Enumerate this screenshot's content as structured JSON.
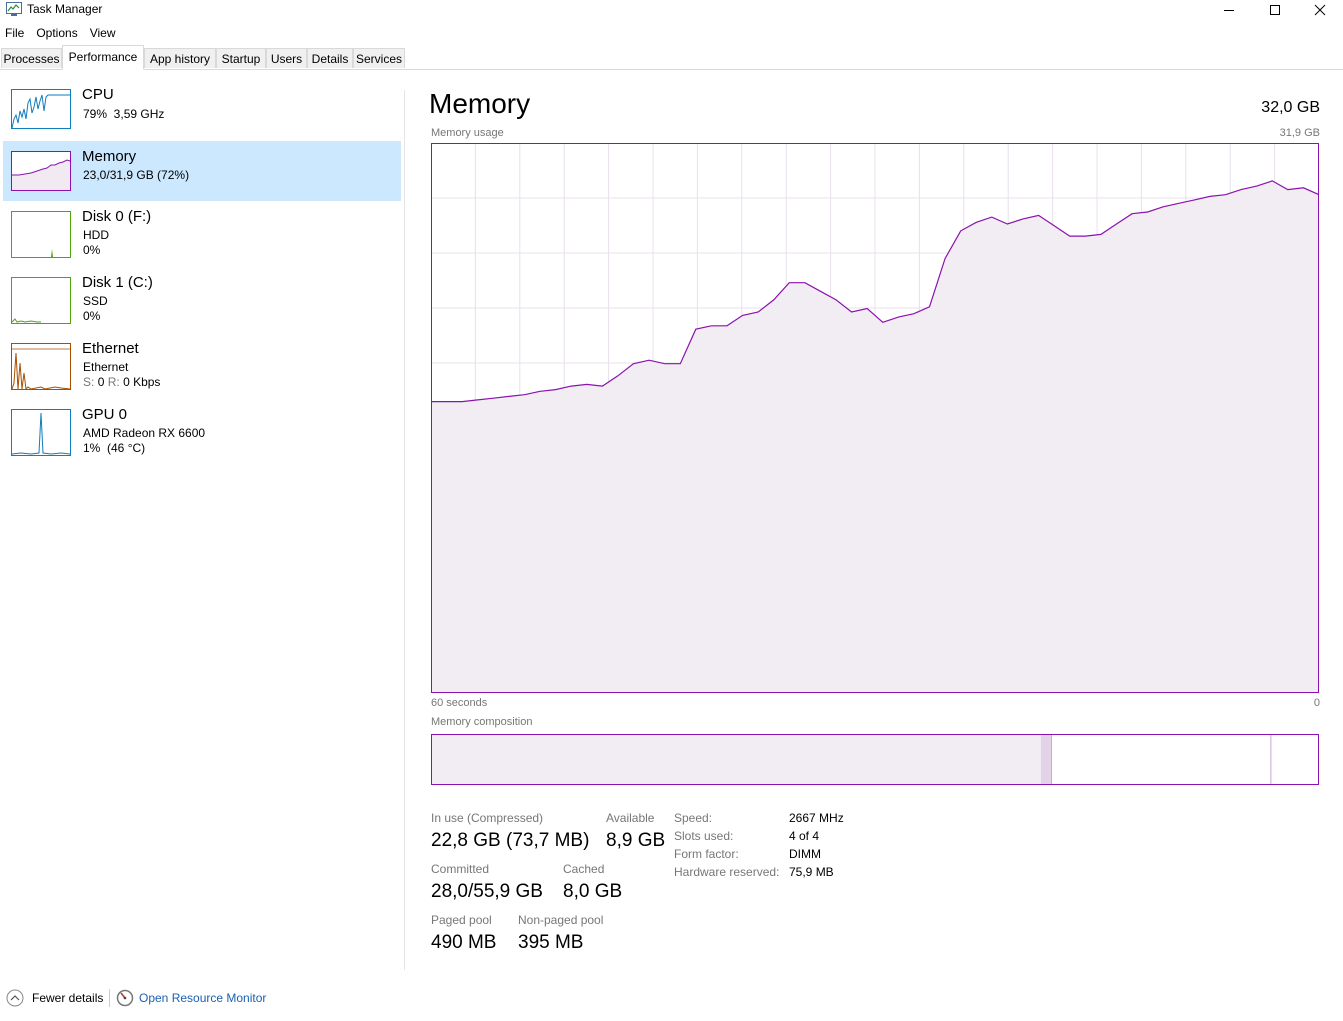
{
  "window": {
    "title": "Task Manager",
    "app_icon": "task-manager-icon"
  },
  "menu": [
    "File",
    "Options",
    "View"
  ],
  "tabs": [
    "Processes",
    "Performance",
    "App history",
    "Startup",
    "Users",
    "Details",
    "Services"
  ],
  "active_tab": "Performance",
  "sidebar": {
    "items": [
      {
        "title": "CPU",
        "sub1": "79%  3,59 GHz",
        "sub2": "",
        "color": "#117dbb"
      },
      {
        "title": "Memory",
        "sub1": "23,0/31,9 GB (72%)",
        "sub2": "",
        "color": "#8b12ae",
        "selected": true
      },
      {
        "title": "Disk 0 (F:)",
        "sub1": "HDD",
        "sub2": "0%",
        "color": "#4da60c"
      },
      {
        "title": "Disk 1 (C:)",
        "sub1": "SSD",
        "sub2": "0%",
        "color": "#4da60c"
      },
      {
        "title": "Ethernet",
        "sub1": "Ethernet",
        "sub2_s": "S:",
        "sub2_s_val": "0",
        "sub2_r": "R:",
        "sub2_r_val": "0 Kbps",
        "color": "#a74f01"
      },
      {
        "title": "GPU 0",
        "sub1": "AMD Radeon RX 6600",
        "sub2": "1%  (46 °C)",
        "color": "#117dbb"
      }
    ]
  },
  "main": {
    "title": "Memory",
    "total": "32,0 GB",
    "usage_label": "Memory usage",
    "usage_max": "31,9 GB",
    "time_left": "60 seconds",
    "time_right": "0",
    "composition_label": "Memory composition",
    "stats": {
      "in_use_label": "In use (Compressed)",
      "in_use": "22,8 GB (73,7 MB)",
      "available_label": "Available",
      "available": "8,9 GB",
      "committed_label": "Committed",
      "committed": "28,0/55,9 GB",
      "cached_label": "Cached",
      "cached": "8,0 GB",
      "paged_label": "Paged pool",
      "paged": "490 MB",
      "nonpaged_label": "Non-paged pool",
      "nonpaged": "395 MB"
    },
    "details": [
      {
        "label": "Speed:",
        "value": "2667 MHz"
      },
      {
        "label": "Slots used:",
        "value": "4 of 4"
      },
      {
        "label": "Form factor:",
        "value": "DIMM"
      },
      {
        "label": "Hardware reserved:",
        "value": "75,9 MB"
      }
    ]
  },
  "footer": {
    "fewer": "Fewer details",
    "resmon": "Open Resource Monitor"
  },
  "chart_data": {
    "type": "area",
    "xlim": [
      60,
      0
    ],
    "ylim": [
      0,
      31.9
    ],
    "series": [
      {
        "values": [
          16.9,
          16.9,
          16.9,
          17.0,
          17.1,
          17.2,
          17.3,
          17.5,
          17.6,
          17.8,
          17.9,
          17.8,
          18.4,
          19.1,
          19.3,
          19.1,
          19.1,
          21.1,
          21.3,
          21.3,
          21.9,
          22.1,
          22.8,
          23.8,
          23.8,
          23.3,
          22.8,
          22.1,
          22.3,
          21.5,
          21.8,
          22.0,
          22.4,
          25.2,
          26.8,
          27.3,
          27.6,
          27.2,
          27.5,
          27.7,
          27.1,
          26.5,
          26.5,
          26.6,
          27.2,
          27.8,
          27.9,
          28.2,
          28.4,
          28.6,
          28.8,
          28.9,
          29.2,
          29.4,
          29.7,
          29.2,
          29.3,
          28.9
        ]
      }
    ],
    "composition_gb": {
      "in_use": 22.8,
      "modified": 0.4,
      "standby": 8.2,
      "free": 1.8
    }
  }
}
